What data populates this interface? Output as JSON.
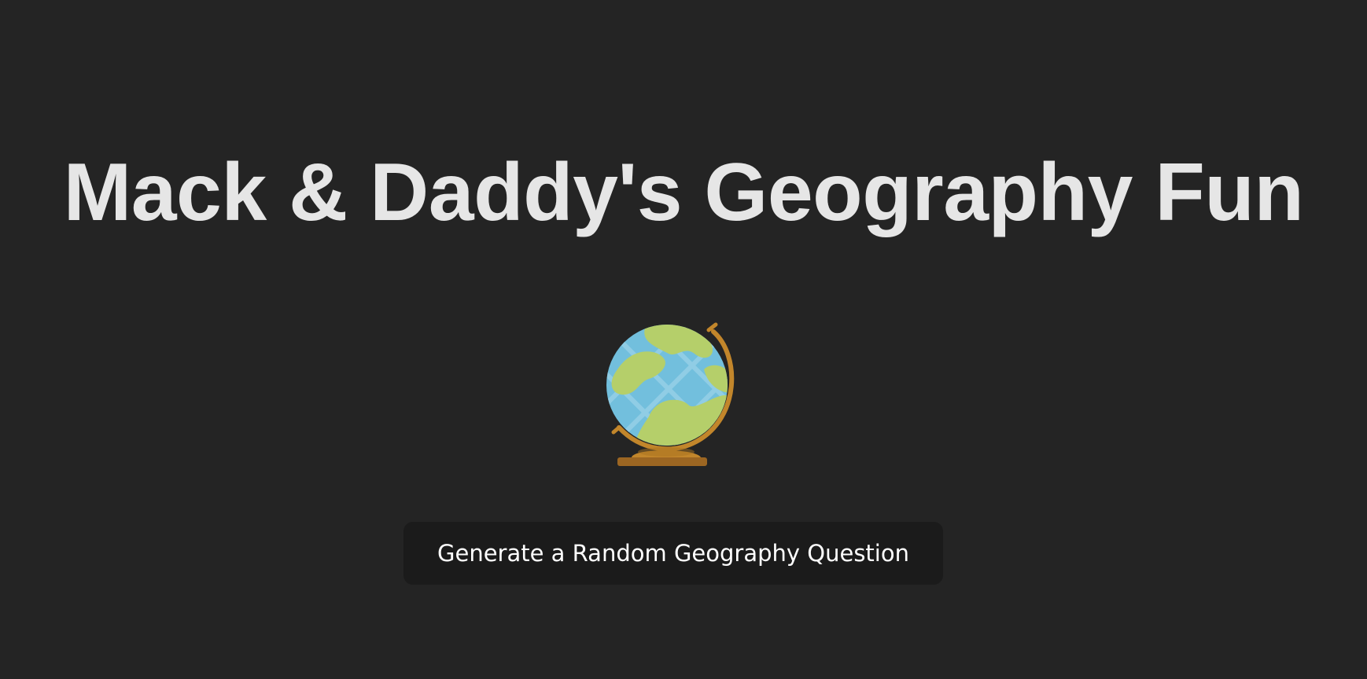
{
  "page": {
    "title": "Mack & Daddy's Geography Fun",
    "icon": "globe-icon",
    "button_label": "Generate a Random Geography Question"
  },
  "colors": {
    "background": "#242424",
    "title_text": "#e6e6e6",
    "button_background": "#1b1b1b",
    "button_text": "#ffffff",
    "globe_ocean": "#72bfdd",
    "globe_land": "#b5cf6a",
    "globe_stand": "#c2862b"
  }
}
